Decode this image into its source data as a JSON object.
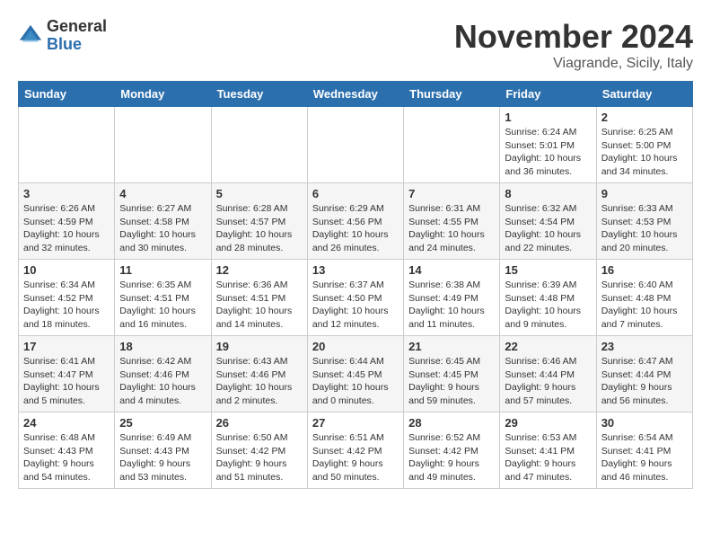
{
  "logo": {
    "general": "General",
    "blue": "Blue"
  },
  "title": "November 2024",
  "location": "Viagrande, Sicily, Italy",
  "days_of_week": [
    "Sunday",
    "Monday",
    "Tuesday",
    "Wednesday",
    "Thursday",
    "Friday",
    "Saturday"
  ],
  "weeks": [
    [
      {
        "day": "",
        "info": ""
      },
      {
        "day": "",
        "info": ""
      },
      {
        "day": "",
        "info": ""
      },
      {
        "day": "",
        "info": ""
      },
      {
        "day": "",
        "info": ""
      },
      {
        "day": "1",
        "info": "Sunrise: 6:24 AM\nSunset: 5:01 PM\nDaylight: 10 hours\nand 36 minutes."
      },
      {
        "day": "2",
        "info": "Sunrise: 6:25 AM\nSunset: 5:00 PM\nDaylight: 10 hours\nand 34 minutes."
      }
    ],
    [
      {
        "day": "3",
        "info": "Sunrise: 6:26 AM\nSunset: 4:59 PM\nDaylight: 10 hours\nand 32 minutes."
      },
      {
        "day": "4",
        "info": "Sunrise: 6:27 AM\nSunset: 4:58 PM\nDaylight: 10 hours\nand 30 minutes."
      },
      {
        "day": "5",
        "info": "Sunrise: 6:28 AM\nSunset: 4:57 PM\nDaylight: 10 hours\nand 28 minutes."
      },
      {
        "day": "6",
        "info": "Sunrise: 6:29 AM\nSunset: 4:56 PM\nDaylight: 10 hours\nand 26 minutes."
      },
      {
        "day": "7",
        "info": "Sunrise: 6:31 AM\nSunset: 4:55 PM\nDaylight: 10 hours\nand 24 minutes."
      },
      {
        "day": "8",
        "info": "Sunrise: 6:32 AM\nSunset: 4:54 PM\nDaylight: 10 hours\nand 22 minutes."
      },
      {
        "day": "9",
        "info": "Sunrise: 6:33 AM\nSunset: 4:53 PM\nDaylight: 10 hours\nand 20 minutes."
      }
    ],
    [
      {
        "day": "10",
        "info": "Sunrise: 6:34 AM\nSunset: 4:52 PM\nDaylight: 10 hours\nand 18 minutes."
      },
      {
        "day": "11",
        "info": "Sunrise: 6:35 AM\nSunset: 4:51 PM\nDaylight: 10 hours\nand 16 minutes."
      },
      {
        "day": "12",
        "info": "Sunrise: 6:36 AM\nSunset: 4:51 PM\nDaylight: 10 hours\nand 14 minutes."
      },
      {
        "day": "13",
        "info": "Sunrise: 6:37 AM\nSunset: 4:50 PM\nDaylight: 10 hours\nand 12 minutes."
      },
      {
        "day": "14",
        "info": "Sunrise: 6:38 AM\nSunset: 4:49 PM\nDaylight: 10 hours\nand 11 minutes."
      },
      {
        "day": "15",
        "info": "Sunrise: 6:39 AM\nSunset: 4:48 PM\nDaylight: 10 hours\nand 9 minutes."
      },
      {
        "day": "16",
        "info": "Sunrise: 6:40 AM\nSunset: 4:48 PM\nDaylight: 10 hours\nand 7 minutes."
      }
    ],
    [
      {
        "day": "17",
        "info": "Sunrise: 6:41 AM\nSunset: 4:47 PM\nDaylight: 10 hours\nand 5 minutes."
      },
      {
        "day": "18",
        "info": "Sunrise: 6:42 AM\nSunset: 4:46 PM\nDaylight: 10 hours\nand 4 minutes."
      },
      {
        "day": "19",
        "info": "Sunrise: 6:43 AM\nSunset: 4:46 PM\nDaylight: 10 hours\nand 2 minutes."
      },
      {
        "day": "20",
        "info": "Sunrise: 6:44 AM\nSunset: 4:45 PM\nDaylight: 10 hours\nand 0 minutes."
      },
      {
        "day": "21",
        "info": "Sunrise: 6:45 AM\nSunset: 4:45 PM\nDaylight: 9 hours\nand 59 minutes."
      },
      {
        "day": "22",
        "info": "Sunrise: 6:46 AM\nSunset: 4:44 PM\nDaylight: 9 hours\nand 57 minutes."
      },
      {
        "day": "23",
        "info": "Sunrise: 6:47 AM\nSunset: 4:44 PM\nDaylight: 9 hours\nand 56 minutes."
      }
    ],
    [
      {
        "day": "24",
        "info": "Sunrise: 6:48 AM\nSunset: 4:43 PM\nDaylight: 9 hours\nand 54 minutes."
      },
      {
        "day": "25",
        "info": "Sunrise: 6:49 AM\nSunset: 4:43 PM\nDaylight: 9 hours\nand 53 minutes."
      },
      {
        "day": "26",
        "info": "Sunrise: 6:50 AM\nSunset: 4:42 PM\nDaylight: 9 hours\nand 51 minutes."
      },
      {
        "day": "27",
        "info": "Sunrise: 6:51 AM\nSunset: 4:42 PM\nDaylight: 9 hours\nand 50 minutes."
      },
      {
        "day": "28",
        "info": "Sunrise: 6:52 AM\nSunset: 4:42 PM\nDaylight: 9 hours\nand 49 minutes."
      },
      {
        "day": "29",
        "info": "Sunrise: 6:53 AM\nSunset: 4:41 PM\nDaylight: 9 hours\nand 47 minutes."
      },
      {
        "day": "30",
        "info": "Sunrise: 6:54 AM\nSunset: 4:41 PM\nDaylight: 9 hours\nand 46 minutes."
      }
    ]
  ]
}
